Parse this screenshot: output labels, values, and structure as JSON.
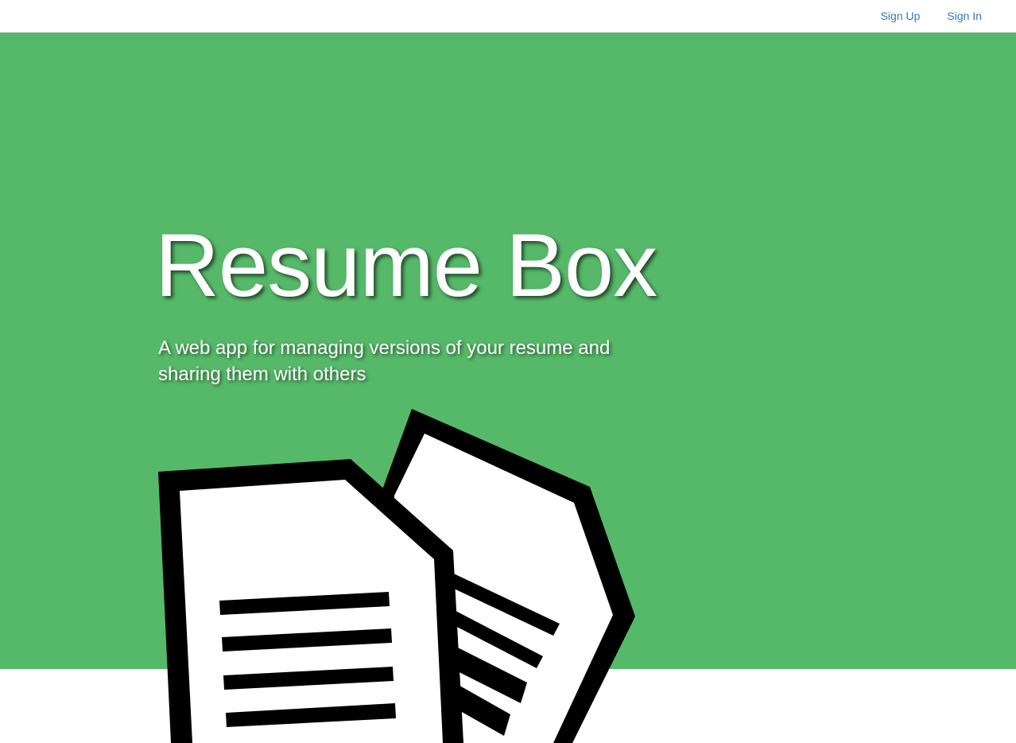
{
  "nav": {
    "sign_up": "Sign Up",
    "sign_in": "Sign In"
  },
  "hero": {
    "title": "Resume Box",
    "subtitle": "A web app for managing versions of your resume and sharing them with others",
    "background_color": "#56b969"
  },
  "illustration": {
    "icon": "documents-icon"
  },
  "colors": {
    "link": "#337ab7",
    "hero_text": "#ffffff",
    "icon_stroke": "#000000"
  }
}
